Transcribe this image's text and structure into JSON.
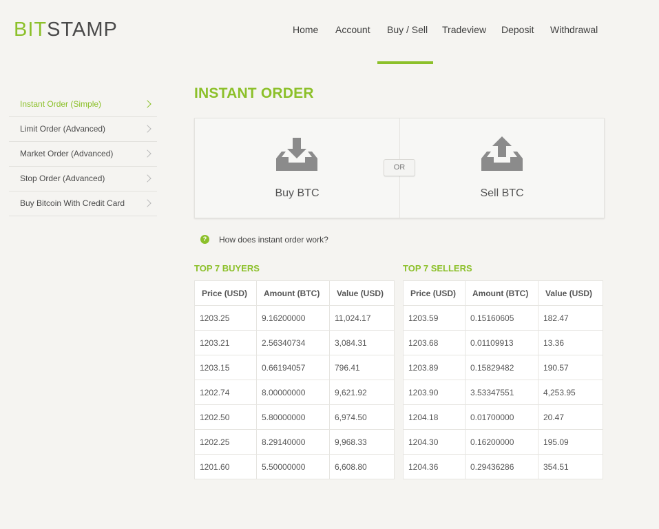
{
  "logo": {
    "part1": "BIT",
    "part2": "STAMP"
  },
  "nav": [
    {
      "label": "Home"
    },
    {
      "label": "Account"
    },
    {
      "label": "Buy / Sell"
    },
    {
      "label": "Tradeview"
    },
    {
      "label": "Deposit"
    },
    {
      "label": "Withdrawal"
    }
  ],
  "sidebar": [
    {
      "label": "Instant Order (Simple)"
    },
    {
      "label": "Limit Order (Advanced)"
    },
    {
      "label": "Market Order (Advanced)"
    },
    {
      "label": "Stop Order (Advanced)"
    },
    {
      "label": "Buy Bitcoin With Credit Card"
    }
  ],
  "title": "INSTANT ORDER",
  "order": {
    "buy_label": "Buy BTC",
    "sell_label": "Sell BTC",
    "or_label": "OR"
  },
  "help": {
    "icon_text": "?",
    "text": "How does instant order work?"
  },
  "accent_color": "#8cc02a",
  "buyers": {
    "title": "TOP 7 BUYERS",
    "headers": [
      "Price (USD)",
      "Amount (BTC)",
      "Value (USD)"
    ],
    "rows": [
      [
        "1203.25",
        "9.16200000",
        "11,024.17"
      ],
      [
        "1203.21",
        "2.56340734",
        "3,084.31"
      ],
      [
        "1203.15",
        "0.66194057",
        "796.41"
      ],
      [
        "1202.74",
        "8.00000000",
        "9,621.92"
      ],
      [
        "1202.50",
        "5.80000000",
        "6,974.50"
      ],
      [
        "1202.25",
        "8.29140000",
        "9,968.33"
      ],
      [
        "1201.60",
        "5.50000000",
        "6,608.80"
      ]
    ]
  },
  "sellers": {
    "title": "TOP 7 SELLERS",
    "headers": [
      "Price (USD)",
      "Amount (BTC)",
      "Value (USD)"
    ],
    "rows": [
      [
        "1203.59",
        "0.15160605",
        "182.47"
      ],
      [
        "1203.68",
        "0.01109913",
        "13.36"
      ],
      [
        "1203.89",
        "0.15829482",
        "190.57"
      ],
      [
        "1203.90",
        "3.53347551",
        "4,253.95"
      ],
      [
        "1204.18",
        "0.01700000",
        "20.47"
      ],
      [
        "1204.30",
        "0.16200000",
        "195.09"
      ],
      [
        "1204.36",
        "0.29436286",
        "354.51"
      ]
    ]
  }
}
